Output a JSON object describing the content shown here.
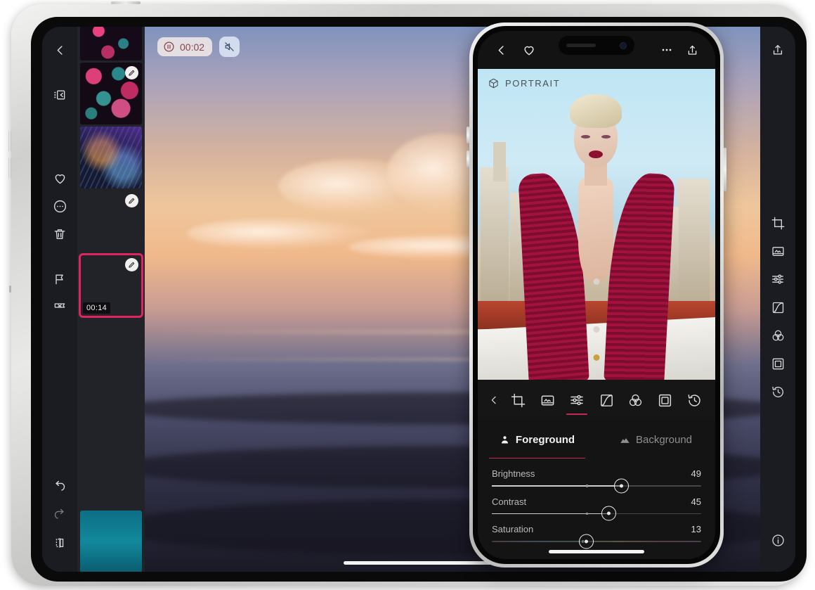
{
  "tablet": {
    "left_rail": {
      "top_items": [
        {
          "name": "back-button",
          "icon": "chevron-left-icon"
        },
        {
          "name": "panel-toggle-button",
          "icon": "filmstrip-panel-icon"
        }
      ],
      "mid_items": [
        {
          "name": "favorite-button",
          "icon": "heart-icon"
        },
        {
          "name": "more-options-button",
          "icon": "circle-ellipsis-icon"
        },
        {
          "name": "delete-button",
          "icon": "trash-icon"
        },
        {
          "name": "flag-button",
          "icon": "flag-icon"
        },
        {
          "name": "reject-button",
          "icon": "flag-x-icon"
        }
      ],
      "bottom_items": [
        {
          "name": "undo-button",
          "icon": "undo-icon",
          "enabled": true
        },
        {
          "name": "redo-button",
          "icon": "redo-icon",
          "enabled": false
        },
        {
          "name": "compare-button",
          "icon": "compare-split-icon",
          "enabled": true
        }
      ]
    },
    "thumbnails": [
      {
        "art": "art-bokeh-top",
        "edited": false,
        "selected": false,
        "duration": ""
      },
      {
        "art": "art-bokeh",
        "edited": true,
        "selected": false,
        "duration": ""
      },
      {
        "art": "art-city",
        "edited": false,
        "selected": false,
        "duration": ""
      },
      {
        "art": "art-towers",
        "edited": true,
        "selected": false,
        "duration": ""
      },
      {
        "art": "art-surfer",
        "edited": true,
        "selected": true,
        "duration": "00:14"
      },
      {
        "art": "art-wave",
        "edited": false,
        "selected": false,
        "duration": ""
      },
      {
        "art": "art-beach",
        "edited": false,
        "selected": false,
        "duration": ""
      },
      {
        "art": "art-pier",
        "edited": false,
        "selected": false,
        "duration": ""
      },
      {
        "art": "art-teal",
        "edited": false,
        "selected": false,
        "duration": ""
      }
    ],
    "playback": {
      "state_icon": "pause-icon",
      "timecode": "00:02",
      "mute_icon": "speaker-muted-icon"
    },
    "right_rail": {
      "share_icon": "share-upload-icon",
      "tools": [
        {
          "name": "crop-tool",
          "icon": "crop-icon"
        },
        {
          "name": "light-tool",
          "icon": "image-frame-icon"
        },
        {
          "name": "adjust-tool",
          "icon": "sliders-icon"
        },
        {
          "name": "curves-tool",
          "icon": "curves-icon"
        },
        {
          "name": "color-mix-tool",
          "icon": "color-circles-icon"
        },
        {
          "name": "border-tool",
          "icon": "square-frame-icon"
        },
        {
          "name": "history-tool",
          "icon": "history-clock-icon"
        }
      ],
      "info_icon": "info-circle-icon"
    }
  },
  "phone": {
    "topbar": {
      "back_icon": "chevron-left-icon",
      "favorite_icon": "heart-icon",
      "more_icon": "ellipsis-icon",
      "share_icon": "share-upload-icon"
    },
    "photo": {
      "badge_label": "PORTRAIT",
      "badge_icon": "cube-3d-icon"
    },
    "toolbar": {
      "back_icon": "chevron-left-icon",
      "items": [
        {
          "name": "crop-tool",
          "icon": "crop-icon",
          "active": false
        },
        {
          "name": "light-tool",
          "icon": "image-frame-icon",
          "active": false
        },
        {
          "name": "adjust-tool",
          "icon": "sliders-icon",
          "active": true
        },
        {
          "name": "curves-tool",
          "icon": "curves-icon",
          "active": false
        },
        {
          "name": "color-mix-tool",
          "icon": "color-circles-icon",
          "active": false
        },
        {
          "name": "border-tool",
          "icon": "square-frame-icon",
          "active": false
        },
        {
          "name": "history-tool",
          "icon": "history-clock-icon",
          "active": false
        }
      ]
    },
    "tabs": [
      {
        "label": "Foreground",
        "icon": "person-icon",
        "active": true
      },
      {
        "label": "Background",
        "icon": "mountains-icon",
        "active": false
      }
    ],
    "sliders": [
      {
        "label": "Brightness",
        "value": "49",
        "pos": 62,
        "tick": 45,
        "rainbow": false
      },
      {
        "label": "Contrast",
        "value": "45",
        "pos": 56,
        "tick": 45,
        "rainbow": false
      },
      {
        "label": "Saturation",
        "value": "13",
        "pos": 45,
        "tick": 43,
        "rainbow": true
      }
    ]
  }
}
